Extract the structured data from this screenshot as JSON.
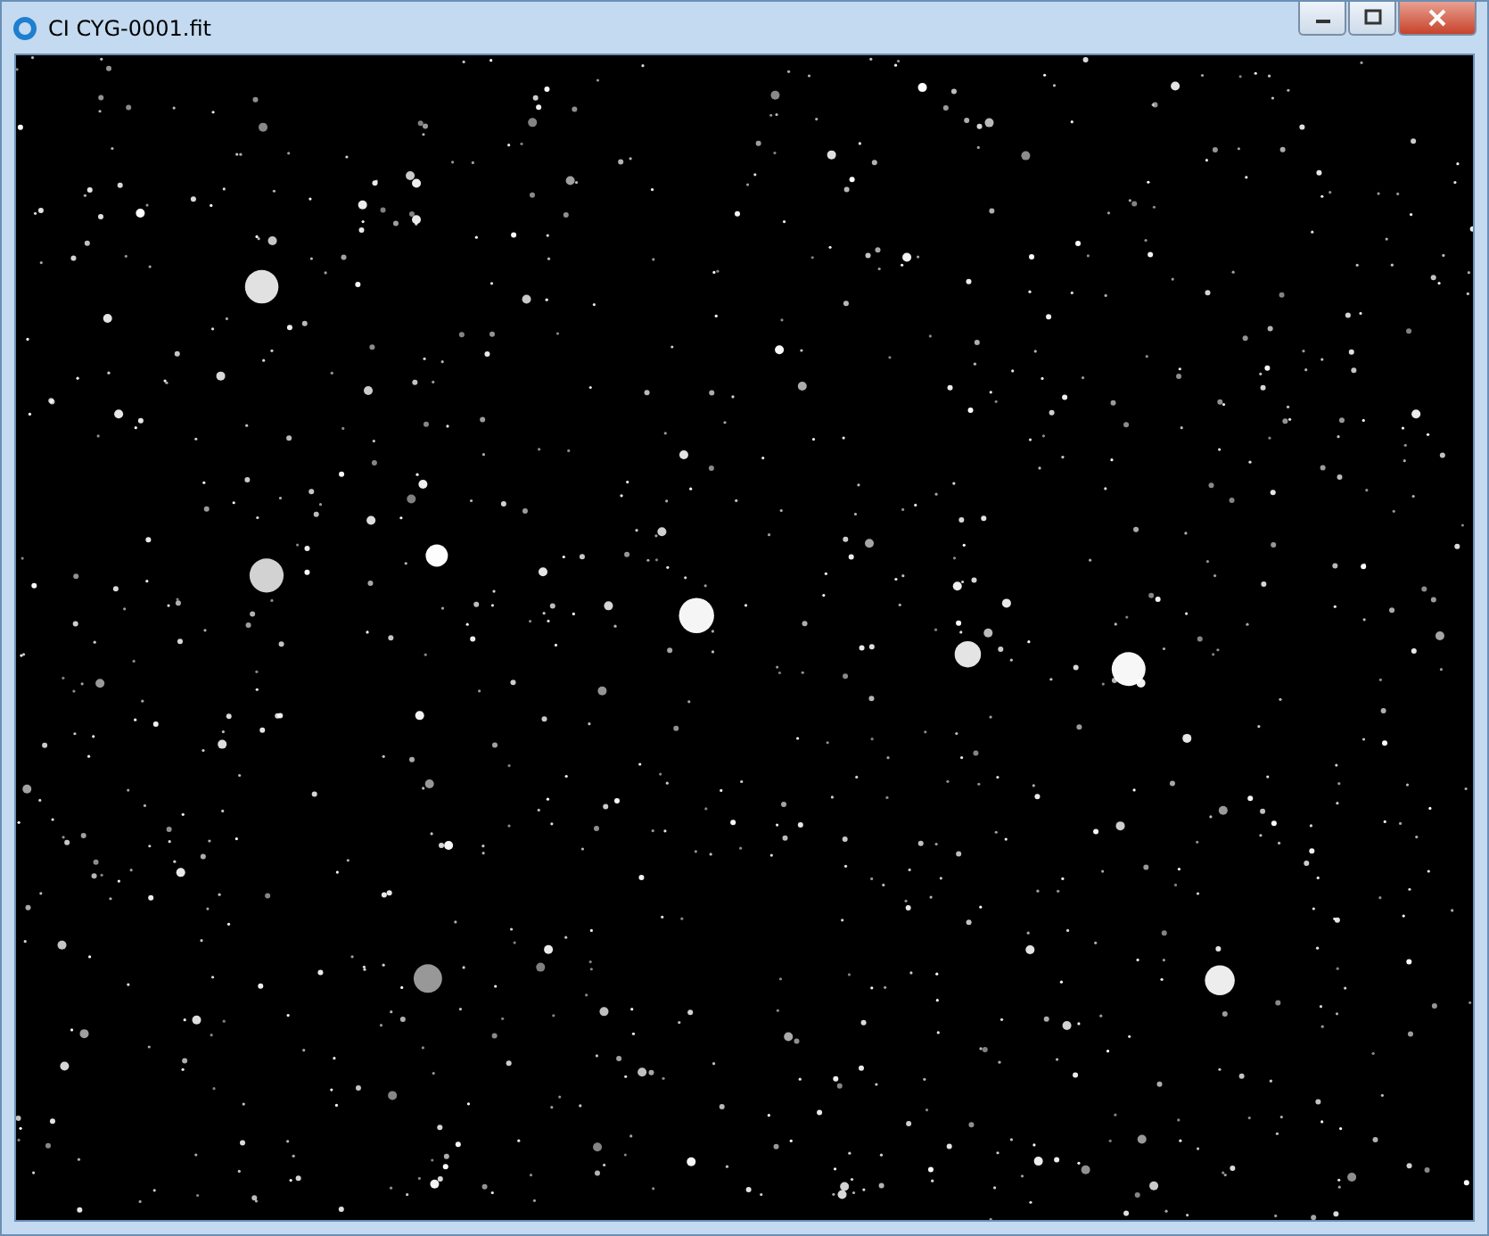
{
  "window": {
    "title": "CI CYG-0001.fit"
  }
}
